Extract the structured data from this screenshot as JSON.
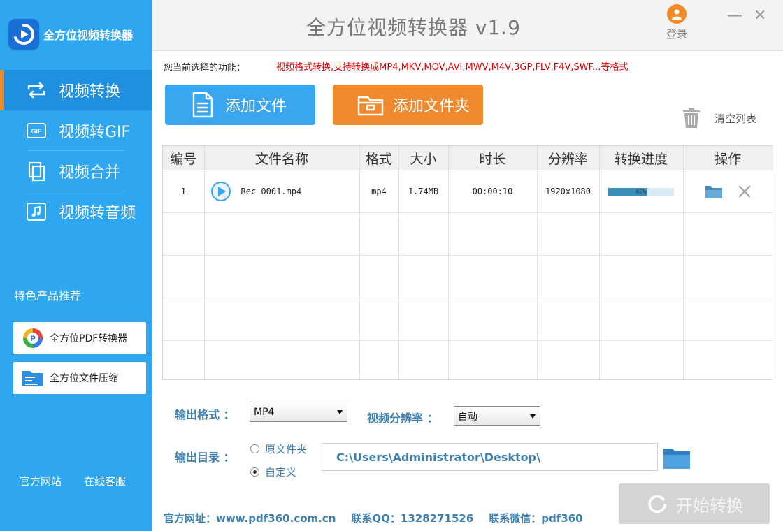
{
  "app": {
    "logo_text": "全方位视频转换器",
    "title": "全方位视频转换器 v1.9",
    "login_label": "登录",
    "minimize_glyph": "—",
    "close_glyph": "✕"
  },
  "sidebar": {
    "nav": [
      {
        "label": "视频转换",
        "icon": "convert-icon",
        "active": true
      },
      {
        "label": "视频转GIF",
        "icon": "gif-icon",
        "active": false
      },
      {
        "label": "视频合并",
        "icon": "merge-icon",
        "active": false
      },
      {
        "label": "视频转音频",
        "icon": "audio-icon",
        "active": false
      }
    ],
    "recommend_title": "特色产品推荐",
    "recommend": [
      {
        "label": "全方位PDF转换器",
        "icon": "pdf-converter-icon"
      },
      {
        "label": "全方位文件压缩",
        "icon": "file-compress-icon"
      }
    ],
    "links": {
      "website": "官方网站",
      "support": "在线客服"
    }
  },
  "toolbar": {
    "function_label": "您当前选择的功能：",
    "function_desc": "视频格式转换,支持转换成MP4,MKV,MOV,AVI,MWV,M4V,3GP,FLV,F4V,SWF...等格式",
    "add_file": "添加文件",
    "add_folder": "添加文件夹",
    "clear_list": "清空列表"
  },
  "table": {
    "headers": [
      "编号",
      "文件名称",
      "格式",
      "大小",
      "时长",
      "分辨率",
      "转换进度",
      "操作"
    ],
    "rows": [
      {
        "index": "1",
        "name": "Rec 0001.mp4",
        "format": "mp4",
        "size": "1.74MB",
        "duration": "00:00:10",
        "resolution": "1920x1080",
        "progress": 60,
        "progress_text": "60%"
      }
    ]
  },
  "settings": {
    "output_format_label": "输出格式 ：",
    "output_format_value": "MP4",
    "resolution_label": "视频分辨率 ：",
    "resolution_value": "自动",
    "output_dir_label": "输出目录 ：",
    "radio_original": "原文件夹",
    "radio_custom": "自定义",
    "radio_selected": "custom",
    "output_path": "C:\\Users\\Administrator\\Desktop\\"
  },
  "start_button": "开始转换",
  "footer": {
    "website": "官方网址：www.pdf360.com.cn",
    "qq": "联系QQ：1328271526",
    "wechat": "联系微信：pdf360"
  },
  "colors": {
    "sidebar": "#2ea6f0",
    "accent_orange": "#ef8a2f",
    "accent_blue": "#3aa6ef",
    "label_blue": "#3e7fae",
    "warning_red": "#e00000"
  }
}
